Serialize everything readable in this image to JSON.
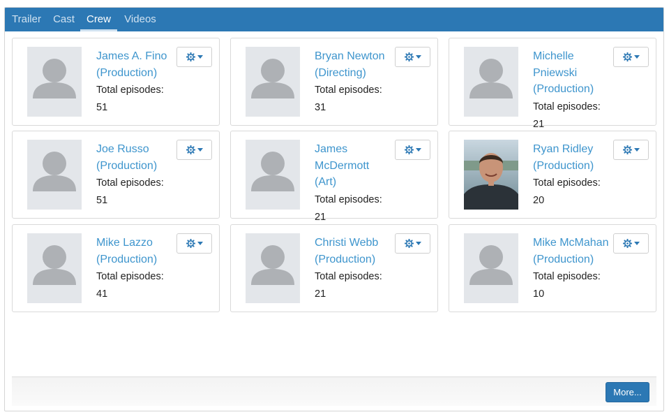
{
  "tabs": [
    {
      "label": "Trailer",
      "active": false
    },
    {
      "label": "Cast",
      "active": false
    },
    {
      "label": "Crew",
      "active": true
    },
    {
      "label": "Videos",
      "active": false
    }
  ],
  "crew": [
    {
      "name": "James A. Fino",
      "department": "(Production)",
      "episodes": "Total episodes: 51",
      "photo": "placeholder"
    },
    {
      "name": "Bryan Newton",
      "department": "(Directing)",
      "episodes": "Total episodes: 31",
      "photo": "placeholder"
    },
    {
      "name": "Michelle Pniewski",
      "department": "(Production)",
      "episodes": "Total episodes: 21",
      "photo": "placeholder"
    },
    {
      "name": "Joe Russo",
      "department": "(Production)",
      "episodes": "Total episodes: 51",
      "photo": "placeholder"
    },
    {
      "name": "James McDermott",
      "department": "(Art)",
      "episodes": "Total episodes: 21",
      "photo": "placeholder"
    },
    {
      "name": "Ryan Ridley",
      "department": "(Production)",
      "episodes": "Total episodes: 20",
      "photo": "portrait"
    },
    {
      "name": "Mike Lazzo",
      "department": "(Production)",
      "episodes": "Total episodes: 41",
      "photo": "placeholder"
    },
    {
      "name": "Christi Webb",
      "department": "(Production)",
      "episodes": "Total episodes: 21",
      "photo": "placeholder"
    },
    {
      "name": "Mike McMahan",
      "department": "(Production)",
      "episodes": "Total episodes: 10",
      "photo": "placeholder"
    }
  ],
  "icons": {
    "settings": "gear-icon",
    "dropdown": "caret-down-icon",
    "avatar": "person-silhouette-icon"
  },
  "footer": {
    "more_label": "More..."
  },
  "colors": {
    "accent": "#2c78b4",
    "link": "#3e95cd",
    "placeholder_bg": "#e3e6ea",
    "silhouette": "#aeb1b5"
  }
}
